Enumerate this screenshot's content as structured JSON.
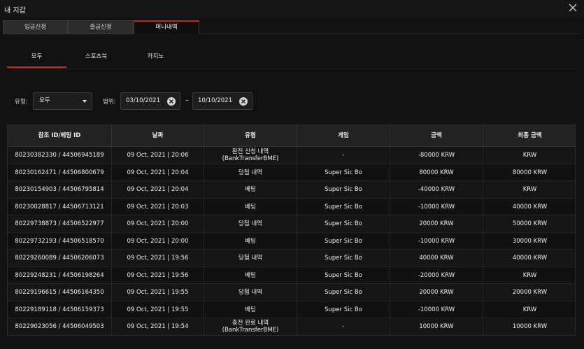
{
  "window": {
    "title": "내 지갑",
    "close_icon": "close-icon"
  },
  "tabs": [
    {
      "label": "입금신청",
      "active": false
    },
    {
      "label": "출금신청",
      "active": false
    },
    {
      "label": "머니내역",
      "active": true
    }
  ],
  "subtabs": [
    {
      "label": "모두",
      "active": true
    },
    {
      "label": "스포츠북",
      "active": false
    },
    {
      "label": "카지노",
      "active": false
    }
  ],
  "filters": {
    "type_label": "유형:",
    "type_value": "모두",
    "range_label": "범위:",
    "date_from": "03/10/2021",
    "date_to": "10/10/2021",
    "separator": "–"
  },
  "table": {
    "headers": [
      "참조 ID/베팅 ID",
      "날짜",
      "유형",
      "게임",
      "금액",
      "최종 금액"
    ],
    "rows": [
      [
        "80230382330 / 44506945189",
        "09 Oct, 2021 | 20:06",
        "환전 신청 내역\n(BankTransferBME)",
        "-",
        "-80000 KRW",
        "KRW"
      ],
      [
        "80230162471 / 44506800679",
        "09 Oct, 2021 | 20:04",
        "당첨 내역",
        "Super Sic Bo",
        "80000 KRW",
        "80000 KRW"
      ],
      [
        "80230154903 / 44506795814",
        "09 Oct, 2021 | 20:04",
        "베팅",
        "Super Sic Bo",
        "-40000 KRW",
        "KRW"
      ],
      [
        "80230028817 / 44506713121",
        "09 Oct, 2021 | 20:03",
        "베팅",
        "Super Sic Bo",
        "-10000 KRW",
        "40000 KRW"
      ],
      [
        "80229738873 / 44506522977",
        "09 Oct, 2021 | 20:00",
        "당첨 내역",
        "Super Sic Bo",
        "20000 KRW",
        "50000 KRW"
      ],
      [
        "80229732193 / 44506518570",
        "09 Oct, 2021 | 20:00",
        "베팅",
        "Super Sic Bo",
        "-10000 KRW",
        "30000 KRW"
      ],
      [
        "80229260089 / 44506206073",
        "09 Oct, 2021 | 19:56",
        "당첨 내역",
        "Super Sic Bo",
        "40000 KRW",
        "40000 KRW"
      ],
      [
        "80229248231 / 44506198264",
        "09 Oct, 2021 | 19:56",
        "베팅",
        "Super Sic Bo",
        "-20000 KRW",
        "KRW"
      ],
      [
        "80229196615 / 44506164350",
        "09 Oct, 2021 | 19:55",
        "당첨 내역",
        "Super Sic Bo",
        "20000 KRW",
        "20000 KRW"
      ],
      [
        "80229189118 / 44506159373",
        "09 Oct, 2021 | 19:55",
        "베팅",
        "Super Sic Bo",
        "-10000 KRW",
        "KRW"
      ],
      [
        "80229023056 / 44506049503",
        "09 Oct, 2021 | 19:54",
        "충전 완료 내역\n(BankTransferBME)",
        "-",
        "10000 KRW",
        "10000 KRW"
      ]
    ]
  },
  "colors": {
    "accent": "#d21f24",
    "background": "#111111",
    "header_bg": "#222222"
  }
}
